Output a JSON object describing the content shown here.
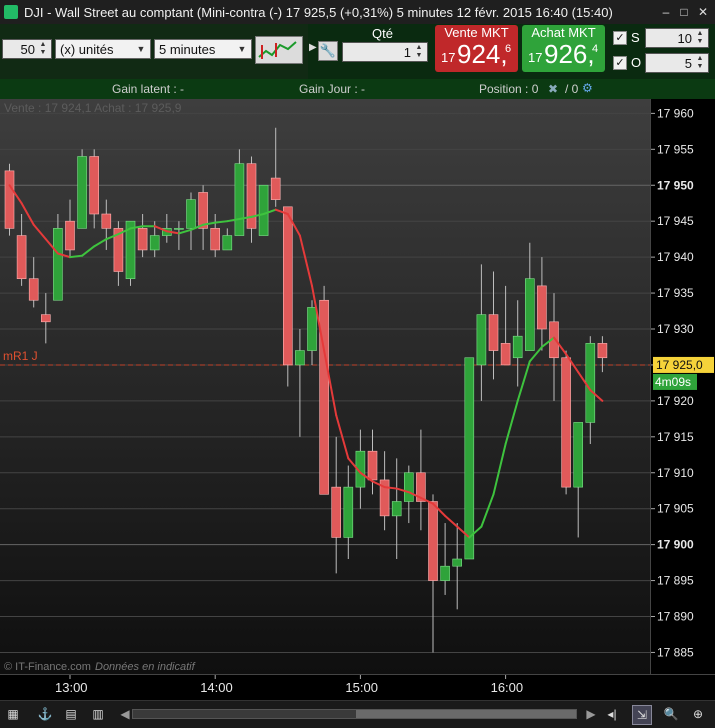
{
  "window": {
    "title": "DJI - Wall Street au comptant (Mini-contra (-)    17 925,5 (+0,31%)    5 minutes   12 févr. 2015 16:40 (15:40)",
    "app_icon": "app-icon",
    "controls": [
      "minimize-icon",
      "maximize-icon",
      "close-icon"
    ]
  },
  "toolbar": {
    "bars_value": "50",
    "units_label": "(x) unités",
    "timeframe_label": "5 minutes",
    "qty_label": "Qté",
    "qty_value": "1",
    "sell": {
      "caption": "Vente MKT",
      "prefix": "17",
      "main": "924,",
      "sup": "6"
    },
    "buy": {
      "caption": "Achat MKT",
      "prefix": "17",
      "main": "926,",
      "sup": "4"
    },
    "s_label": "S",
    "s_value": "10",
    "o_label": "O",
    "o_value": "5"
  },
  "infobar": {
    "gain_latent": "Gain latent : -",
    "gain_jour": "Gain Jour : -",
    "position": "Position : 0",
    "position2": "/ 0"
  },
  "overlay": {
    "bidask": "Vente : 17 924,1 Achat : 17 925,9",
    "level_label": "mR1 J",
    "copyright": "© IT-Finance.com",
    "disclaimer": "Données en indicatif"
  },
  "price_axis": {
    "ticks": [
      "17 960",
      "17 955",
      "17 950",
      "17 945",
      "17 940",
      "17 935",
      "17 930",
      "17 925",
      "17 920",
      "17 915",
      "17 910",
      "17 905",
      "17 900",
      "17 895",
      "17 890",
      "17 885"
    ],
    "bold_ticks": [
      "17 950",
      "17 900"
    ],
    "current_price": "17 925,0",
    "countdown": "4m09s"
  },
  "time_axis": {
    "ticks": [
      "13:00",
      "14:00",
      "15:00",
      "16:00"
    ]
  },
  "chart_data": {
    "type": "candlestick",
    "y_range": [
      17882,
      17962
    ],
    "level_value": 17925,
    "candles": [
      [
        17952,
        17953,
        17943,
        17944
      ],
      [
        17943,
        17946,
        17936,
        17937
      ],
      [
        17937,
        17940,
        17933,
        17934
      ],
      [
        17932,
        17935,
        17928,
        17931
      ],
      [
        17934,
        17946,
        17934,
        17944
      ],
      [
        17945,
        17948,
        17940,
        17941
      ],
      [
        17944,
        17955,
        17944,
        17954
      ],
      [
        17954,
        17955,
        17944,
        17946
      ],
      [
        17946,
        17948,
        17941,
        17944
      ],
      [
        17944,
        17945,
        17936,
        17938
      ],
      [
        17937,
        17945,
        17936,
        17945
      ],
      [
        17944,
        17946,
        17940,
        17941
      ],
      [
        17941,
        17945,
        17940,
        17943
      ],
      [
        17943,
        17946,
        17942,
        17944
      ],
      [
        17944,
        17945,
        17941,
        17944
      ],
      [
        17944,
        17949,
        17941,
        17948
      ],
      [
        17949,
        17950,
        17941,
        17944
      ],
      [
        17944,
        17946,
        17940,
        17941
      ],
      [
        17941,
        17944,
        17941,
        17943
      ],
      [
        17943,
        17955,
        17943,
        17953
      ],
      [
        17953,
        17954,
        17942,
        17944
      ],
      [
        17943,
        17950,
        17943,
        17950
      ],
      [
        17951,
        17958,
        17947,
        17948
      ],
      [
        17947,
        17947,
        17922,
        17925
      ],
      [
        17925,
        17930,
        17915,
        17927
      ],
      [
        17927,
        17934,
        17925,
        17933
      ],
      [
        17934,
        17936,
        17907,
        17907
      ],
      [
        17908,
        17915,
        17896,
        17901
      ],
      [
        17901,
        17911,
        17898,
        17908
      ],
      [
        17908,
        17916,
        17905,
        17913
      ],
      [
        17913,
        17916,
        17907,
        17909
      ],
      [
        17909,
        17913,
        17902,
        17904
      ],
      [
        17904,
        17912,
        17898,
        17906
      ],
      [
        17906,
        17911,
        17903,
        17910
      ],
      [
        17910,
        17916,
        17902,
        17906
      ],
      [
        17906,
        17907,
        17885,
        17895
      ],
      [
        17895,
        17903,
        17893,
        17897
      ],
      [
        17897,
        17903,
        17891,
        17898
      ],
      [
        17898,
        17923,
        17898,
        17926
      ],
      [
        17925,
        17939,
        17920,
        17932
      ],
      [
        17932,
        17938,
        17923,
        17927
      ],
      [
        17928,
        17936,
        17925,
        17925
      ],
      [
        17926,
        17934,
        17922,
        17929
      ],
      [
        17927,
        17942,
        17927,
        17937
      ],
      [
        17936,
        17940,
        17927,
        17930
      ],
      [
        17931,
        17935,
        17920,
        17926
      ],
      [
        17926,
        17927,
        17907,
        17908
      ],
      [
        17908,
        17914,
        17901,
        17917
      ],
      [
        17917,
        17929,
        17914,
        17928
      ],
      [
        17928,
        17929,
        17924,
        17926
      ]
    ],
    "ma": [
      17950,
      17947.5,
      17944.5,
      17942.5,
      17940.5,
      17940,
      17940.2,
      17941.5,
      17942.5,
      17943.2,
      17944,
      17944.3,
      17944.3,
      17943.6,
      17943.3,
      17943.8,
      17944.5,
      17944.8,
      17945,
      17945.3,
      17945.6,
      17946,
      17946.6,
      17946,
      17943,
      17936,
      17927,
      17918,
      17912,
      17910,
      17908.8,
      17908,
      17907.8,
      17907.3,
      17906.5,
      17905.7,
      17904,
      17902.5,
      17901,
      17902.5,
      17907,
      17914,
      17920,
      17925.5,
      17927.5,
      17928.8,
      17926.5,
      17924,
      17921.5,
      17920
    ]
  },
  "statusbar": {
    "left_icons": [
      "layout-icon",
      "pin-icon",
      "chart-export-icon",
      "chart-settings-icon",
      "chart-add-icon"
    ],
    "right_icons": [
      "step-back-icon",
      "pause-icon",
      "fit-icon",
      "zoom-out-icon",
      "zoom-in-icon"
    ]
  }
}
